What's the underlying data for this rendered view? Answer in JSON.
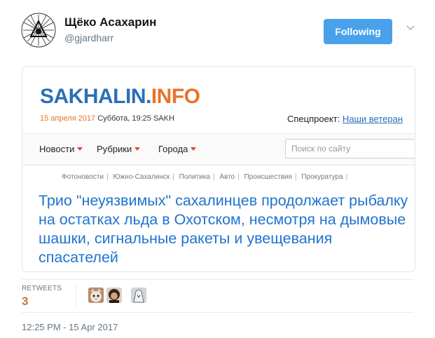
{
  "tweet": {
    "author_name": "Щёко Асахарин",
    "author_handle": "@gjardharr",
    "follow_label": "Following",
    "retweets_label": "RETWEETS",
    "retweets_count": "3",
    "timestamp": "12:25 PM - 15 Apr 2017"
  },
  "card": {
    "logo_part1": "SAKHALIN.",
    "logo_part2": "INFO",
    "date_red": "15 апреля 2017",
    "date_rest": " Суббота, 19:25 SAKH",
    "special_label": "Спецпроект: ",
    "special_link": "Наши ветеран",
    "nav": [
      "Новости",
      "Рубрики",
      "Города"
    ],
    "search_placeholder": "Поиск по сайту",
    "subnav": [
      "Фотоновости",
      "Южно-Сахалинск",
      "Политика",
      "Авто",
      "Происшествия",
      "Прокуратура"
    ],
    "headline": "Трио \"неуязвимых\" сахалинцев продолжает рыбалку на остатках льда в Охотском, несмотря на дымовые шашки, сигнальные ракеты и увещевания спасателей"
  },
  "icons": {
    "avatar": "mystic-symbol-icon",
    "caret": "chevron-down-icon"
  },
  "colors": {
    "follow_button": "#4aa1eb",
    "link_blue": "#1f73cf",
    "logo_orange": "#e8742a",
    "retweet_count": "#c7773a"
  }
}
